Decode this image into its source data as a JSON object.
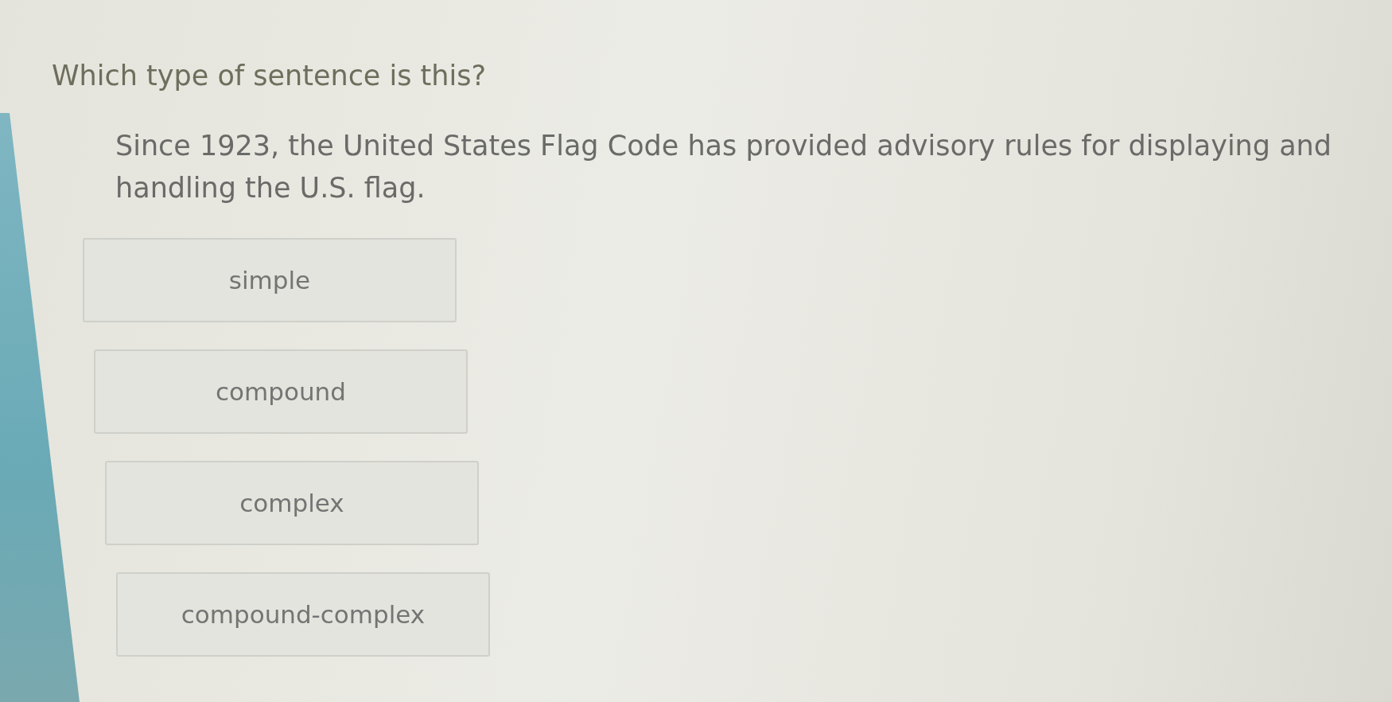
{
  "question": {
    "prompt": "Which type of sentence is this?",
    "passage": "Since 1923, the United States Flag Code has provided advisory rules for displaying and handling the U.S. flag."
  },
  "choices": [
    {
      "label": "simple",
      "selected": false
    },
    {
      "label": "compound",
      "selected": false
    },
    {
      "label": "complex",
      "selected": false
    },
    {
      "label": "compound-complex",
      "selected": false
    }
  ]
}
